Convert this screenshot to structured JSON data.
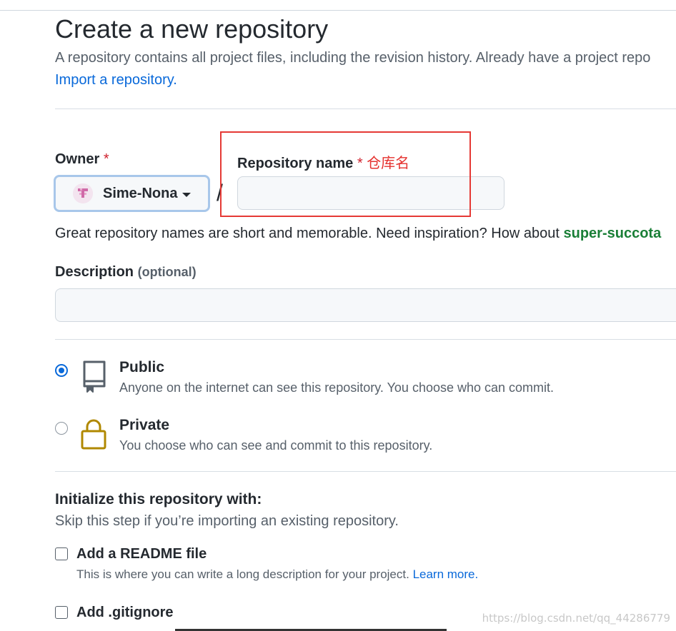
{
  "page": {
    "title": "Create a new repository",
    "description": "A repository contains all project files, including the revision history. Already have a project repo",
    "import_link": "Import a repository."
  },
  "owner": {
    "label": "Owner",
    "required_mark": "*",
    "selected": "Sime-Nona"
  },
  "slash": "/",
  "repo_name": {
    "label": "Repository name",
    "required_mark": "*",
    "annotation": "仓库名",
    "value": ""
  },
  "name_hint": {
    "text": "Great repository names are short and memorable. Need inspiration? How about ",
    "suggestion": "super-succota"
  },
  "description_field": {
    "label": "Description",
    "optional": "(optional)",
    "value": ""
  },
  "visibility": {
    "selected": "public",
    "options": [
      {
        "title": "Public",
        "desc": "Anyone on the internet can see this repository. You choose who can commit.",
        "icon": "repo-icon"
      },
      {
        "title": "Private",
        "desc": "You choose who can see and commit to this repository.",
        "icon": "lock-icon"
      }
    ]
  },
  "init": {
    "title": "Initialize this repository with:",
    "desc": "Skip this step if you’re importing an existing repository.",
    "readme": {
      "label": "Add a README file",
      "desc": "This is where you can write a long description for your project.",
      "learn_more": "Learn more."
    },
    "gitignore": {
      "label": "Add .gitignore"
    }
  },
  "watermark": "https://blog.csdn.net/qq_44286779",
  "colors": {
    "accent": "#0969da",
    "required": "#cf222e",
    "annotation": "#e53935",
    "suggestion": "#1a7f37",
    "lock_icon": "#b08800"
  }
}
